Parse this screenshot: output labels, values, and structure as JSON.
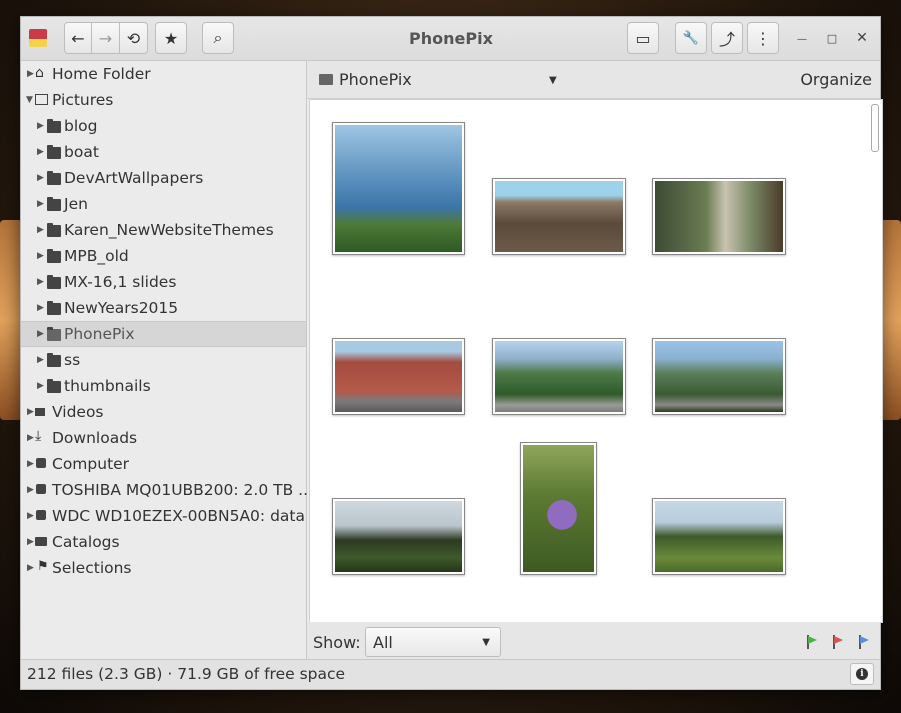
{
  "window": {
    "title": "PhonePix"
  },
  "toolbar": {
    "back": "←",
    "forward": "→",
    "history": "⟲",
    "bookmark": "★",
    "search": "⌕",
    "slideshow": "▭",
    "tools": "🔧",
    "share": "⤴",
    "menu": "⋮",
    "minimize": "—",
    "maximize": "□",
    "close": "✕"
  },
  "sidebar": {
    "items": [
      {
        "label": "Home Folder"
      },
      {
        "label": "Pictures"
      },
      {
        "label": "blog"
      },
      {
        "label": "boat"
      },
      {
        "label": "DevArtWallpapers"
      },
      {
        "label": "Jen"
      },
      {
        "label": "Karen_NewWebsiteThemes"
      },
      {
        "label": "MPB_old"
      },
      {
        "label": "MX-16,1 slides"
      },
      {
        "label": "NewYears2015"
      },
      {
        "label": "PhonePix"
      },
      {
        "label": "ss"
      },
      {
        "label": "thumbnails"
      },
      {
        "label": "Videos"
      },
      {
        "label": "Downloads"
      },
      {
        "label": "Computer"
      },
      {
        "label": "TOSHIBA MQ01UBB200: 2.0 TB ..."
      },
      {
        "label": "WDC WD10EZEX-00BN5A0: data"
      },
      {
        "label": "Catalogs"
      },
      {
        "label": "Selections"
      }
    ]
  },
  "location": {
    "folder": "PhonePix",
    "organize": "Organize"
  },
  "filter": {
    "label": "Show:",
    "value": "All"
  },
  "flags": {
    "green": "#4caf50",
    "red": "#d9534f",
    "blue": "#5b8fd6"
  },
  "status": {
    "text": "212 files (2.3 GB)  ·  71.9 GB of free space"
  }
}
